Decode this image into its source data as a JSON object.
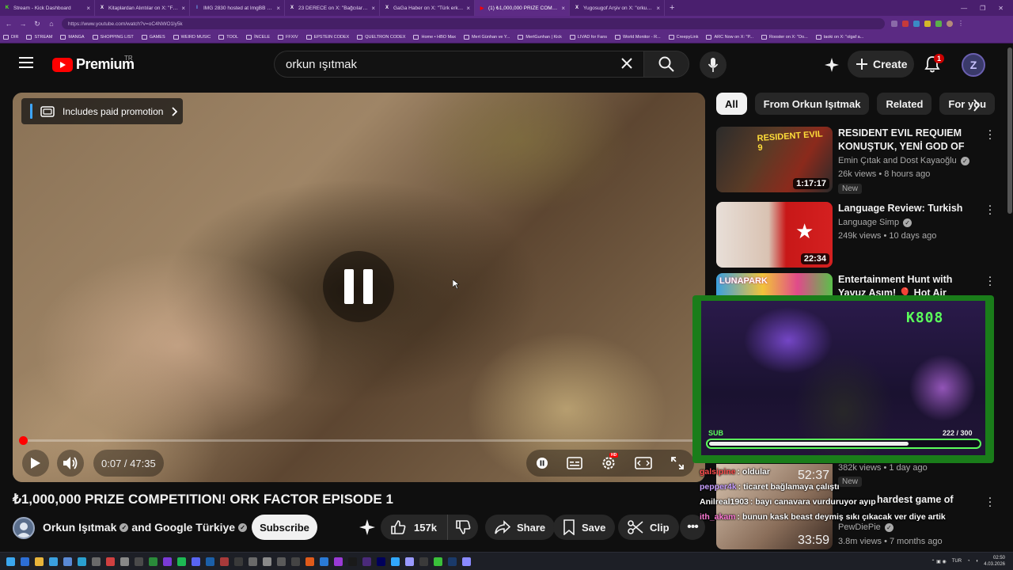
{
  "browser": {
    "tabs": [
      {
        "label": "Stream - Kick Dashboard",
        "icon": "K",
        "color": "#53fc18"
      },
      {
        "label": "Kitaplardan Alıntılar on X: \"Filozof",
        "icon": "X",
        "color": "#ffffff"
      },
      {
        "label": "IMG 2830 hosted at ImgBB — Img",
        "icon": "I",
        "color": "#6fb3ff"
      },
      {
        "label": "23 DERECE on X: \"Bağcılar'da döv",
        "icon": "X",
        "color": "#ffffff"
      },
      {
        "label": "GaGa Haber on X: \"Türk erkekleri",
        "icon": "X",
        "color": "#ffffff"
      },
      {
        "label": "(1) ₺1,000,000 PRIZE COMPETI",
        "icon": "▶",
        "color": "#ff0000"
      },
      {
        "label": "Yugosugof Arşiv on X: \"orkun ışıtm",
        "icon": "X",
        "color": "#ffffff"
      }
    ],
    "new_tab": "+",
    "url": "https://www.youtube.com/watch?v=oC4NWO1ly5k",
    "bookmarks": [
      "DIR",
      "STREAM",
      "MANGA",
      "SHOPPING LIST",
      "GAMES",
      "WEIRD MUSIC",
      "TOOL",
      "İNCELE",
      "FFXIV",
      "EPSTEIN CODEX",
      "QUELTRON CODEX",
      "Home • HBO Max",
      "Mert Günhan ve Y...",
      "MertGunhan | Kick",
      "LIVAD for Fans",
      "World Monitor - R...",
      "CreepyLink",
      "ARC Now on X: \"P...",
      "Rooster on X: \"Do...",
      "taoki on X: \"olgaf a..."
    ]
  },
  "header": {
    "logo": "Premium",
    "country": "TR",
    "search_query": "orkun ışıtmak",
    "create_label": "Create",
    "notification_count": "1",
    "avatar_letter": "Z"
  },
  "player": {
    "promo_label": "Includes paid promotion",
    "time": "0:07 / 47:35",
    "progress_fraction": 0.0025
  },
  "video": {
    "title": "₺1,000,000 PRIZE COMPETITION! ORK FACTOR EPISODE 1",
    "channel": "Orkun Işıtmak",
    "collab": "and Google Türkiye",
    "subscribe_label": "Subscribe",
    "likes": "157k",
    "share_label": "Share",
    "save_label": "Save",
    "clip_label": "Clip",
    "more_label": "•••"
  },
  "sidebar": {
    "chips": [
      "All",
      "From Orkun Işıtmak",
      "Related",
      "For you"
    ],
    "recs": [
      {
        "title": "RESIDENT EVIL REQUIEM KONUŞTUK, YENİ GOD OF WA...",
        "channel": "Emin Çıtak and Dost Kayaoğlu",
        "meta": "26k views • 8 hours ago",
        "badge": "New",
        "duration": "1:17:17"
      },
      {
        "title": "Language Review: Turkish",
        "channel": "Language Simp",
        "meta": "249k views • 10 days ago",
        "duration": "22:34"
      },
      {
        "title": "Entertainment Hunt with Yavuz Asım! 🎈 Hot Air Balloon &...",
        "channel": "",
        "meta": ""
      },
      {
        "title": "hardest game of",
        "channel": "PewDiePie",
        "meta": "3.8m views • 7 months ago",
        "duration": "33:59"
      }
    ],
    "rec_extra": {
      "meta": "382k views • 1 day ago",
      "badge": "New",
      "duration": "52:37"
    }
  },
  "webcam": {
    "logo": "K808",
    "sub_label": "SUB",
    "sub_count": "222 / 300",
    "sub_fraction": 0.74
  },
  "chat": [
    {
      "user": "galsipine",
      "msg": ": oldular",
      "color": "#ff4d4d"
    },
    {
      "user": "pepper4k",
      "msg": ": ticaret bağlamaya çalıştı",
      "color": "#c9a0ff"
    },
    {
      "user": "Anilreal1903",
      "msg": ": bayı canavara vurduruyor ayıp",
      "color": "#ffffff"
    },
    {
      "user": "ith_akam",
      "msg": ": bunun kask beast deymiş sıkı çıkacak ver diye artik",
      "color": "#ff7ad6"
    }
  ],
  "taskbar": {
    "lang": "TUR",
    "time": "02:50",
    "date": "4.03.2026"
  }
}
